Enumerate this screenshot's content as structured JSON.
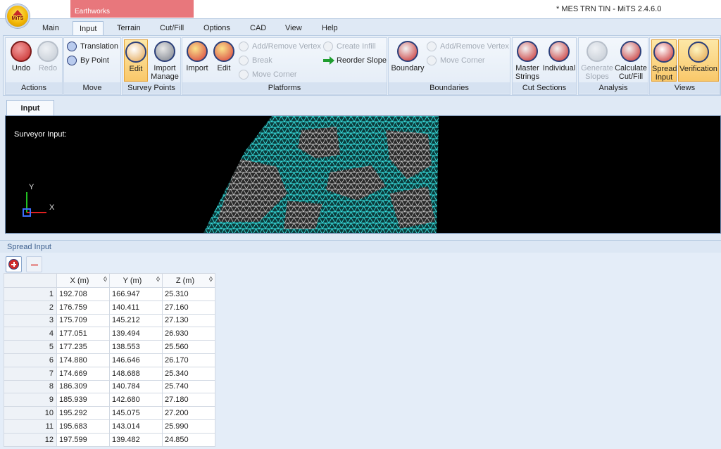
{
  "window": {
    "title": "* MES TRN TIN - MiTS 2.4.6.0",
    "context_tab": "Earthworks",
    "logo_text": "MiTS"
  },
  "menu": {
    "tabs": [
      "Main",
      "Input",
      "Terrain",
      "Cut/Fill",
      "Options",
      "CAD",
      "View",
      "Help"
    ],
    "active": "Input"
  },
  "ribbon": {
    "actions": {
      "label": "Actions",
      "undo": "Undo",
      "redo": "Redo"
    },
    "move": {
      "label": "Move",
      "translation": "Translation",
      "by_point": "By Point"
    },
    "survey_points": {
      "label": "Survey Points",
      "edit": "Edit",
      "import_manage_1": "Import",
      "import_manage_2": "Manage"
    },
    "platforms": {
      "label": "Platforms",
      "import": "Import",
      "edit": "Edit",
      "add_remove_vertex": "Add/Remove Vertex",
      "break": "Break",
      "move_corner": "Move Corner",
      "create_infill": "Create Infill",
      "reorder_slope": "Reorder Slope"
    },
    "boundaries": {
      "label": "Boundaries",
      "boundary": "Boundary",
      "add_remove_vertex": "Add/Remove Vertex",
      "move_corner": "Move Corner"
    },
    "cut_sections": {
      "label": "Cut Sections",
      "master_1": "Master",
      "master_2": "Strings",
      "individual": "Individual"
    },
    "analysis": {
      "label": "Analysis",
      "generate_1": "Generate",
      "generate_2": "Slopes",
      "calculate_1": "Calculate",
      "calculate_2": "Cut/Fill"
    },
    "views": {
      "label": "Views",
      "spread_1": "Spread",
      "spread_2": "Input",
      "verification": "Verification"
    }
  },
  "document": {
    "tab": "Input",
    "viewport_label": "Surveyor Input:",
    "axis_x": "X",
    "axis_y": "Y"
  },
  "spread_input": {
    "title": "Spread Input",
    "columns": [
      "X (m)",
      "Y (m)",
      "Z (m)"
    ],
    "sort_glyph": "◊",
    "rows": [
      [
        "1",
        "192.708",
        "166.947",
        "25.310"
      ],
      [
        "2",
        "176.759",
        "140.411",
        "27.160"
      ],
      [
        "3",
        "175.709",
        "145.212",
        "27.130"
      ],
      [
        "4",
        "177.051",
        "139.494",
        "26.930"
      ],
      [
        "5",
        "177.235",
        "138.553",
        "25.560"
      ],
      [
        "6",
        "174.880",
        "146.646",
        "26.170"
      ],
      [
        "7",
        "174.669",
        "148.688",
        "25.340"
      ],
      [
        "8",
        "186.309",
        "140.784",
        "25.740"
      ],
      [
        "9",
        "185.939",
        "142.680",
        "27.180"
      ],
      [
        "10",
        "195.292",
        "145.075",
        "27.200"
      ],
      [
        "11",
        "195.683",
        "143.014",
        "25.990"
      ],
      [
        "12",
        "197.599",
        "139.482",
        "24.850"
      ]
    ]
  },
  "colors": {
    "mesh": "#38e0e0",
    "accent_orange": "#f9c86a",
    "viewport_bg": "#000000"
  }
}
